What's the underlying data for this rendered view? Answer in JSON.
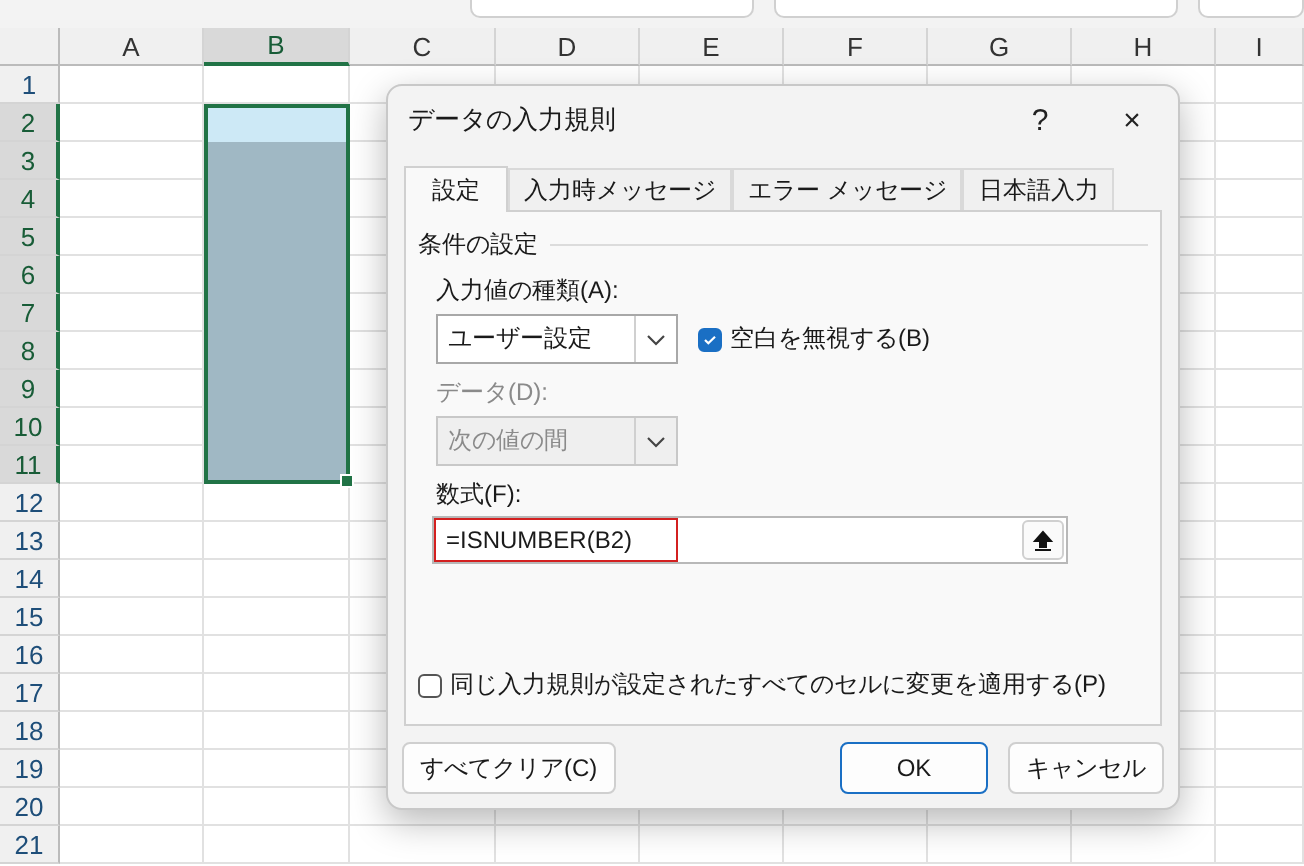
{
  "sheet": {
    "columns": [
      {
        "label": "A",
        "selected": false
      },
      {
        "label": "B",
        "selected": true
      },
      {
        "label": "C",
        "selected": false
      },
      {
        "label": "D",
        "selected": false
      },
      {
        "label": "E",
        "selected": false
      },
      {
        "label": "F",
        "selected": false
      },
      {
        "label": "G",
        "selected": false
      },
      {
        "label": "H",
        "selected": false
      },
      {
        "label": "I",
        "selected": false
      }
    ],
    "rows": [
      {
        "label": "1",
        "selected": false
      },
      {
        "label": "2",
        "selected": true
      },
      {
        "label": "3",
        "selected": true
      },
      {
        "label": "4",
        "selected": true
      },
      {
        "label": "5",
        "selected": true
      },
      {
        "label": "6",
        "selected": true
      },
      {
        "label": "7",
        "selected": true
      },
      {
        "label": "8",
        "selected": true
      },
      {
        "label": "9",
        "selected": true
      },
      {
        "label": "10",
        "selected": true
      },
      {
        "label": "11",
        "selected": true
      },
      {
        "label": "12",
        "selected": false
      },
      {
        "label": "13",
        "selected": false
      },
      {
        "label": "14",
        "selected": false
      },
      {
        "label": "15",
        "selected": false
      },
      {
        "label": "16",
        "selected": false
      },
      {
        "label": "17",
        "selected": false
      },
      {
        "label": "18",
        "selected": false
      },
      {
        "label": "19",
        "selected": false
      },
      {
        "label": "20",
        "selected": false
      },
      {
        "label": "21",
        "selected": false
      }
    ]
  },
  "dialog": {
    "title": "データの入力規則",
    "help": "?",
    "close": "×",
    "tabs": [
      {
        "label": "設定",
        "selected": true
      },
      {
        "label": "入力時メッセージ",
        "selected": false
      },
      {
        "label": "エラー メッセージ",
        "selected": false
      },
      {
        "label": "日本語入力",
        "selected": false
      }
    ],
    "group_title": "条件の設定",
    "allow": {
      "label": "入力値の種類(A):",
      "value": "ユーザー設定",
      "disabled": false
    },
    "ignore_blank": {
      "label": "空白を無視する(B)",
      "checked": true
    },
    "data": {
      "label": "データ(D):",
      "value": "次の値の間",
      "disabled": true
    },
    "formula": {
      "label": "数式(F):",
      "value": "=ISNUMBER(B2)",
      "highlighted": true
    },
    "apply_all": {
      "label": "同じ入力規則が設定されたすべてのセルに変更を適用する(P)",
      "checked": false
    },
    "buttons": [
      {
        "label": "すべてクリア(C)",
        "kind": "secondary"
      },
      {
        "label": "OK",
        "kind": "default"
      },
      {
        "label": "キャンセル",
        "kind": "secondary"
      }
    ]
  }
}
